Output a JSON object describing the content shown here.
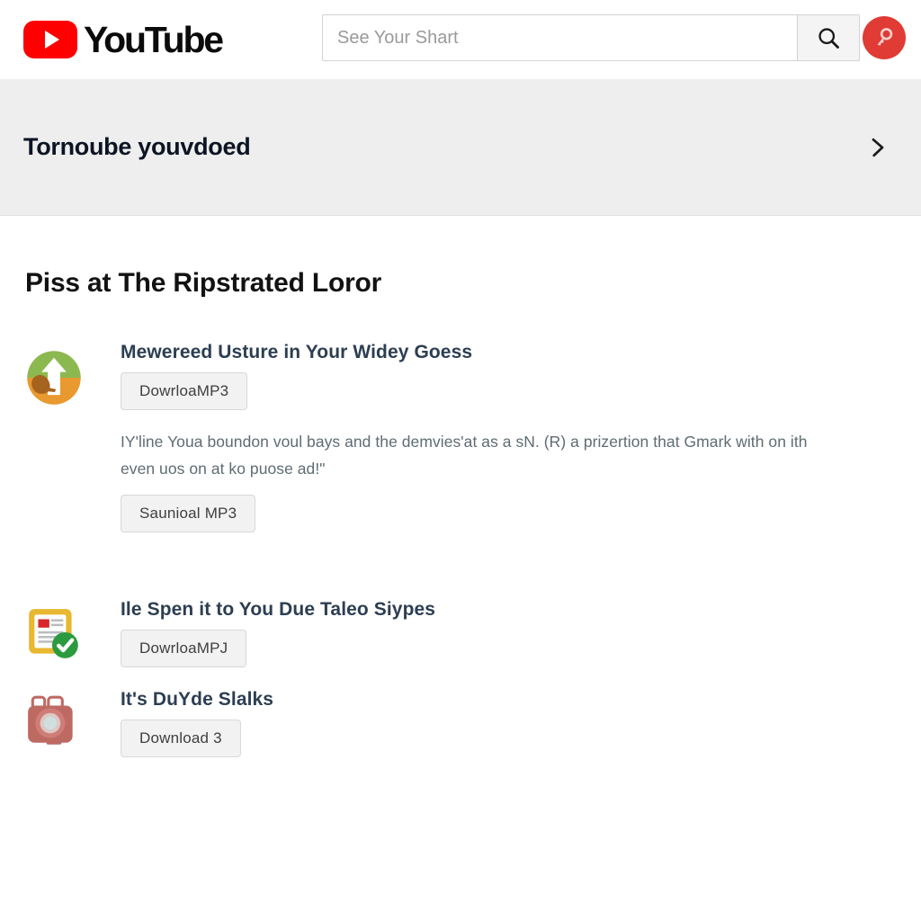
{
  "header": {
    "logo_text": "YouTube",
    "logo_icon": "youtube-play-icon",
    "search": {
      "placeholder": "See Your Shart",
      "value": "",
      "button_icon": "search-icon"
    },
    "avatar_icon": "account-avatar-icon",
    "accent_color": "#ff0000"
  },
  "banner": {
    "text": "Tornoube youvdoed",
    "close_icon": "chevron-right-icon",
    "background_color": "#eeeeee"
  },
  "main": {
    "title": "Piss at The Ripstrated Loror",
    "items": [
      {
        "icon": "upload-arrow-icon",
        "title": "Mewereed Usture in Your Widey Goess",
        "button": "DowrloaMP3",
        "description": "IY'line Youa boundon voul bays and the demvies'at as a sN. (R) a prizertion that Gmark with on ith even uos on at ko puose ad!\"",
        "secondary_button": "Saunioal MP3"
      },
      {
        "icon": "document-check-icon",
        "title": "Ile Spen it to You Due Taleo Siypes",
        "button": "DowrloaMPJ"
      },
      {
        "icon": "camera-icon",
        "title": "It's DuYde Slalks",
        "button": "Download 3"
      }
    ]
  }
}
